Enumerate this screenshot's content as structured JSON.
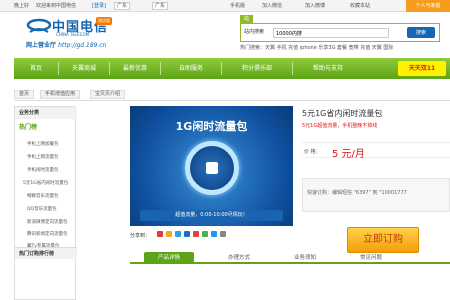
{
  "topbar": {
    "city": "晚上好",
    "welcome": "欢迎来到中国电信",
    "login": "[登录]",
    "region1": "广东",
    "region2": "广东",
    "mobile": "手机版",
    "join_wx": "加入微信",
    "join_weibo": "加入微博",
    "fav": "收藏本站",
    "home": "个人与家庭"
  },
  "logo": {
    "cn": "中国电信",
    "en": "CHINA TELECOM",
    "badge": "测试版",
    "hall": "网上营业厅",
    "url": "http://gd.189.cn"
  },
  "search": {
    "tab_site": "站内搜索",
    "label": "站内搜索",
    "value": "10000内搜",
    "button": "搜索",
    "hot": "热门搜索：天翼  手机  充值  iphone  乐享3G  套餐  宽带  充值  天翼  国际"
  },
  "nav": {
    "items": [
      "首页",
      "天翼商城",
      "最新优惠",
      "自助服务",
      "积分俱乐部",
      "帮助与支持"
    ],
    "promo": "天天双11"
  },
  "crumbs": [
    "首页",
    "手机增值应用",
    "宝贝贝介绍"
  ],
  "sidebar": {
    "head": "业务分类",
    "hot": "热门榜",
    "items": [
      "手机上网加餐包",
      "手机上网流量包",
      "手机闲时流量包",
      "5元1G省内闲时流量包",
      "畅聊音乐流量包",
      "QQ音乐流量包",
      "新浪微博定向流量包",
      "腾讯新闻定向流量包",
      "翼Tv专属流量包"
    ],
    "foot": "热门订购排行榜"
  },
  "product": {
    "image_title": "1G闲时流量包",
    "image_bar": "超值流量，0:00-10:00尽情玩！",
    "title": "5元1G省内闲时流量包",
    "subtitle": "5元1G超值流量，手机整晚不掉线",
    "price_label": "价  格：",
    "price": "5 元/月",
    "order_info": "快速订购：编辑短信 \"6397\" 到 \"10001777",
    "buy": "立即订购",
    "share": "分享到："
  },
  "tabs": [
    "产品详情",
    "办理方式",
    "业务须知",
    "常见问题"
  ],
  "colors": {
    "brand_blue": "#1467b3",
    "nav_green": "#5da417",
    "accent_orange": "#f79b1c",
    "price_red": "#e21515"
  }
}
